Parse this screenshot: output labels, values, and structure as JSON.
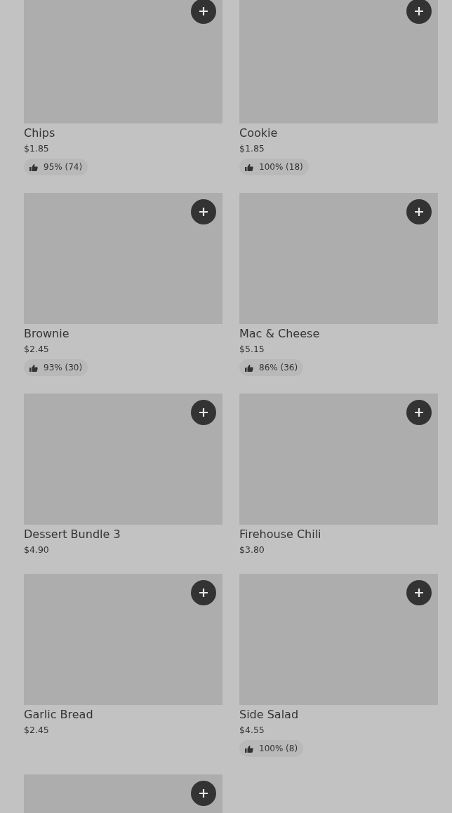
{
  "items": [
    {
      "kind": "full",
      "name": "Chips",
      "price": "$1.85",
      "rating": "95% (74)"
    },
    {
      "kind": "full",
      "name": "Cookie",
      "price": "$1.85",
      "rating": "100% (18)"
    },
    {
      "kind": "full",
      "name": "Brownie",
      "price": "$2.45",
      "rating": "93% (30)"
    },
    {
      "kind": "full",
      "name": "Mac & Cheese",
      "price": "$5.15",
      "rating": "86% (36)"
    },
    {
      "kind": "full",
      "name": "Dessert Bundle 3",
      "price": "$4.90"
    },
    {
      "kind": "full",
      "name": "Firehouse Chili",
      "price": "$3.80"
    },
    {
      "kind": "full",
      "name": "Garlic Bread",
      "price": "$2.45"
    },
    {
      "kind": "full",
      "name": "Side Salad",
      "price": "$4.55",
      "rating": "100% (8)"
    },
    {
      "kind": "cut-off"
    }
  ]
}
